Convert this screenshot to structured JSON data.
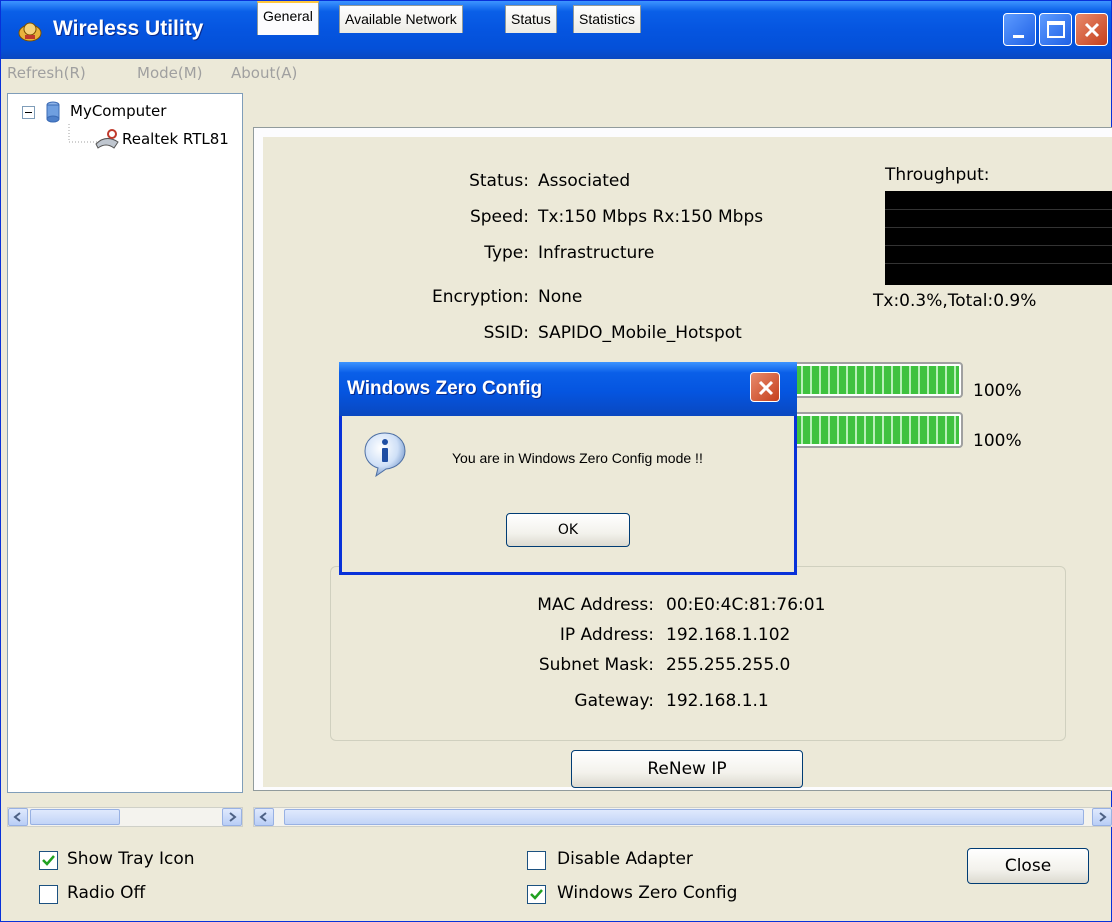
{
  "window": {
    "title": "Wireless Utility"
  },
  "menu": {
    "items": [
      "Refresh(R)",
      "Mode(M)",
      "About(A)"
    ]
  },
  "tree": {
    "root": "MyComputer",
    "child": "Realtek RTL81"
  },
  "tabs": [
    "General",
    "Available Network",
    "Status",
    "Statistics"
  ],
  "general": {
    "status_label": "Status:",
    "status_value": "Associated",
    "speed_label": "Speed:",
    "speed_value": "Tx:150 Mbps Rx:150 Mbps",
    "type_label": "Type:",
    "type_value": "Infrastructure",
    "encryption_label": "Encryption:",
    "encryption_value": "None",
    "ssid_label": "SSID:",
    "ssid_value": "SAPIDO_Mobile_Hotspot",
    "throughput_label": "Throughput:",
    "throughput_value": "Tx:0.3%,Total:0.9%",
    "signal_percent_1": "100%",
    "signal_percent_2": "100%",
    "signal_level_1": 1.0,
    "signal_level_2": 1.0
  },
  "network": {
    "mac_label": "MAC Address:",
    "mac_value": "00:E0:4C:81:76:01",
    "ip_label": "IP Address:",
    "ip_value": "192.168.1.102",
    "subnet_label": "Subnet Mask:",
    "subnet_value": "255.255.255.0",
    "gateway_label": "Gateway:",
    "gateway_value": "192.168.1.1"
  },
  "renew_label": "ReNew IP",
  "options": {
    "show_tray_icon": {
      "label": "Show Tray Icon",
      "checked": true
    },
    "radio_off": {
      "label": "Radio Off",
      "checked": false
    },
    "disable_adapter": {
      "label": "Disable Adapter",
      "checked": false
    },
    "windows_zero_config": {
      "label": "Windows Zero Config",
      "checked": true
    }
  },
  "close_label": "Close",
  "dialog": {
    "title": "Windows Zero Config",
    "message": "You are in Windows Zero Config mode !!",
    "ok_label": "OK"
  },
  "colors": {
    "titlebar": "#0555e0",
    "window_bg": "#ece9d8",
    "signal": "#3fc23f",
    "tab_highlight": "#ffc83c"
  }
}
